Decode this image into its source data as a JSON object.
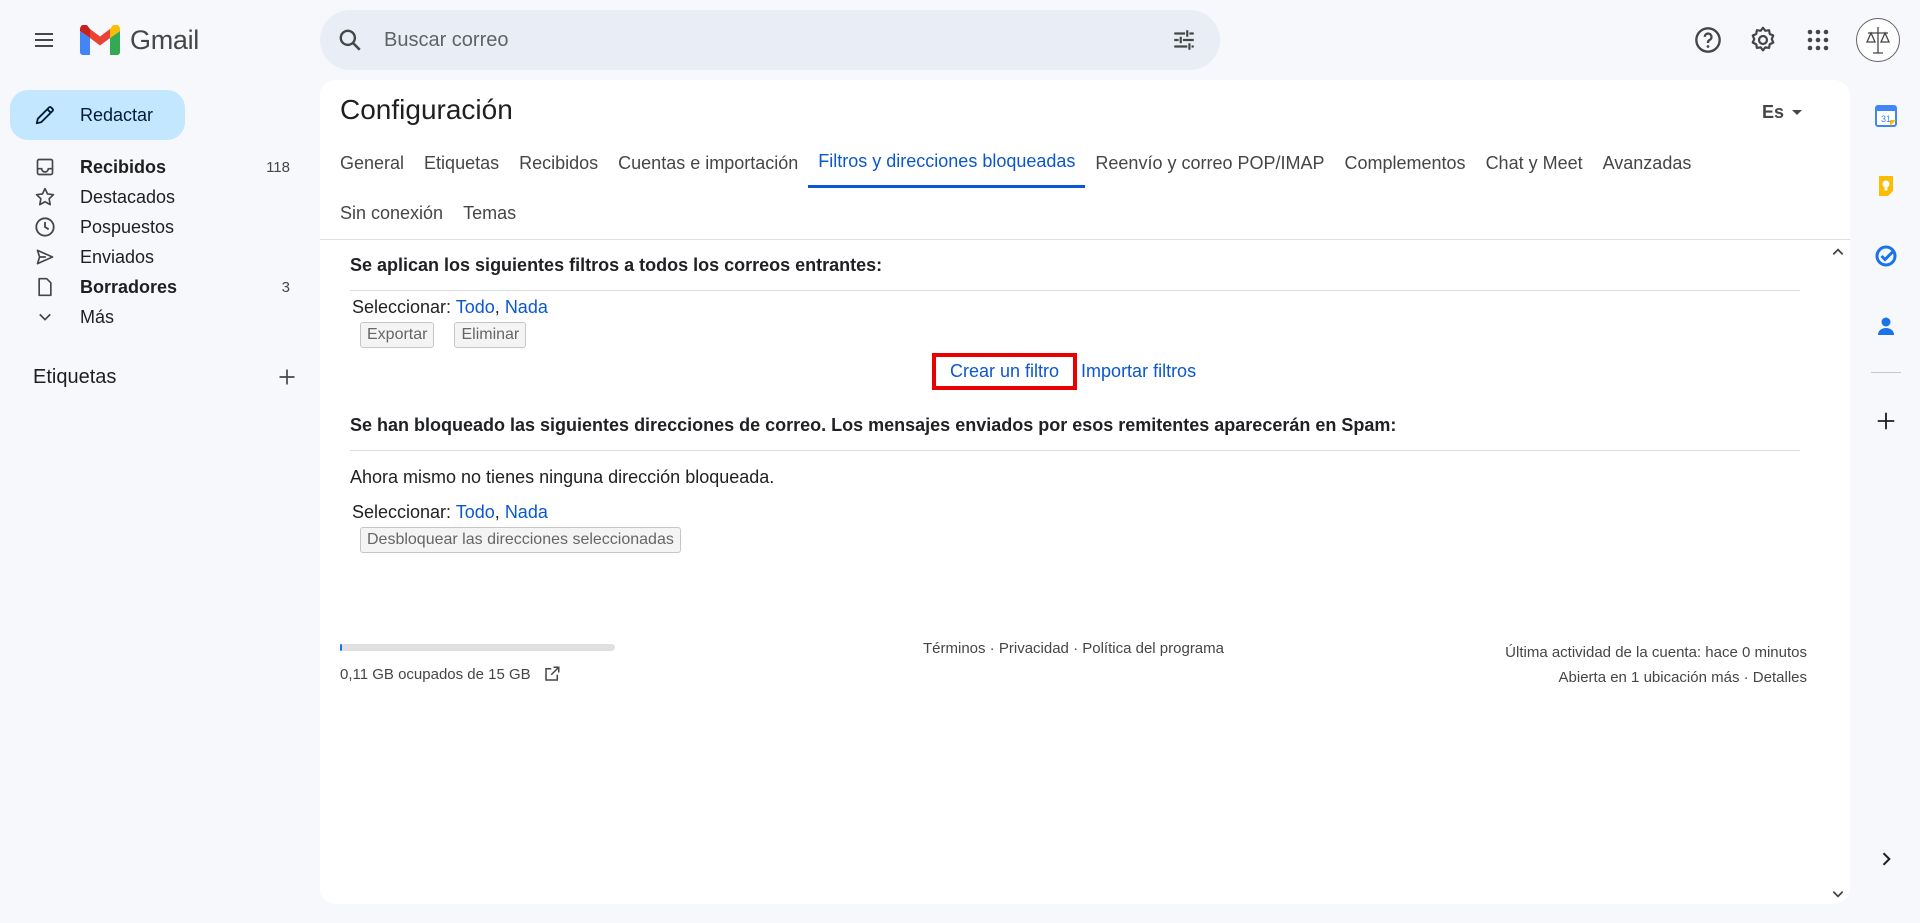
{
  "header": {
    "app_name": "Gmail",
    "search_placeholder": "Buscar correo"
  },
  "sidebar": {
    "compose_label": "Redactar",
    "items": [
      {
        "label": "Recibidos",
        "count": "118",
        "icon": "inbox-icon",
        "bold": true
      },
      {
        "label": "Destacados",
        "count": "",
        "icon": "star-icon",
        "bold": false
      },
      {
        "label": "Pospuestos",
        "count": "",
        "icon": "clock-icon",
        "bold": false
      },
      {
        "label": "Enviados",
        "count": "",
        "icon": "send-icon",
        "bold": false
      },
      {
        "label": "Borradores",
        "count": "3",
        "icon": "draft-icon",
        "bold": true
      },
      {
        "label": "Más",
        "count": "",
        "icon": "chevron-down-icon",
        "bold": false
      }
    ],
    "labels_title": "Etiquetas"
  },
  "settings": {
    "title": "Configuración",
    "language": "Es",
    "tabs_row1": [
      "General",
      "Etiquetas",
      "Recibidos",
      "Cuentas e importación",
      "Filtros y direcciones bloqueadas",
      "Reenvío y correo POP/IMAP",
      "Complementos",
      "Chat y Meet",
      "Avanzadas"
    ],
    "tabs_row2": [
      "Sin conexión",
      "Temas"
    ],
    "active_tab": "Filtros y direcciones bloqueadas"
  },
  "filters": {
    "heading": "Se aplican los siguientes filtros a todos los correos entrantes:",
    "select_label": "Seleccionar:",
    "select_all": "Todo",
    "select_none": "Nada",
    "export_button": "Exportar",
    "delete_button": "Eliminar",
    "create_filter": "Crear un filtro",
    "import_filters": "Importar filtros"
  },
  "blocked": {
    "heading": "Se han bloqueado las siguientes direcciones de correo. Los mensajes enviados por esos remitentes aparecerán en Spam:",
    "empty_message": "Ahora mismo no tienes ninguna dirección bloqueada.",
    "select_label": "Seleccionar:",
    "select_all": "Todo",
    "select_none": "Nada",
    "unblock_button": "Desbloquear las direcciones seleccionadas"
  },
  "footer": {
    "storage": "0,11 GB ocupados de 15 GB",
    "storage_fraction": 0.007,
    "terms": "Términos",
    "privacy": "Privacidad",
    "program_policy": "Política del programa",
    "separator": " · ",
    "last_activity": "Última actividad de la cuenta: hace 0 minutos",
    "open_in": "Abierta en 1 ubicación más",
    "details": "Detalles"
  },
  "side_panel": {
    "calendar_day": "31",
    "icons": [
      "calendar-icon",
      "keep-icon",
      "tasks-icon",
      "contacts-icon",
      "add-icon",
      "expand-icon"
    ]
  },
  "colors": {
    "accent": "#0b57d0",
    "compose_bg": "#c2e7ff",
    "page_bg": "#f6f8fc",
    "highlight_box": "#ea0000"
  }
}
